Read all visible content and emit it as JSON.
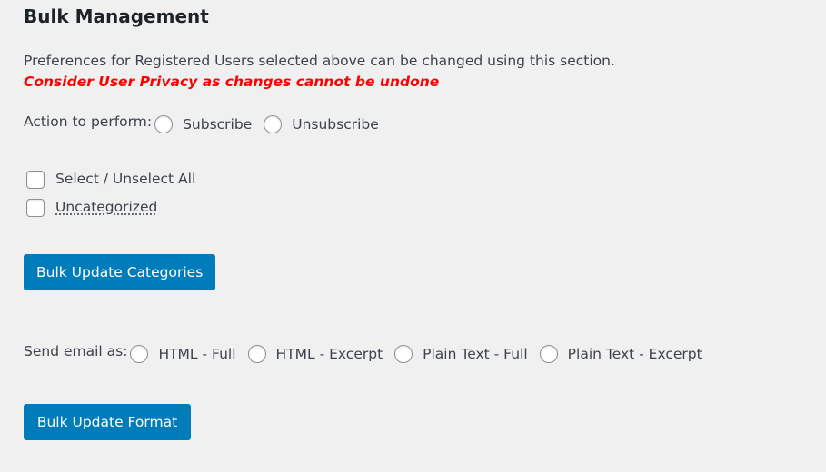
{
  "section": {
    "title": "Bulk Management",
    "description": "Preferences for Registered Users selected above can be changed using this section.",
    "warning": "Consider User Privacy as changes cannot be undone",
    "warning_color": "#ff0000"
  },
  "action": {
    "label": "Action to perform:",
    "options": [
      {
        "label": "Subscribe",
        "checked": false
      },
      {
        "label": "Unsubscribe",
        "checked": false
      }
    ]
  },
  "categories": {
    "select_all_label": "Select / Unselect All",
    "items": [
      {
        "label": "Uncategorized",
        "checked": false
      }
    ]
  },
  "buttons": {
    "bulk_update_categories": "Bulk Update Categories",
    "bulk_update_format": "Bulk Update Format",
    "accent_color": "#007cba"
  },
  "format": {
    "label": "Send email as:",
    "options": [
      {
        "label": "HTML - Full",
        "checked": false
      },
      {
        "label": "HTML - Excerpt",
        "checked": false
      },
      {
        "label": "Plain Text - Full",
        "checked": false
      },
      {
        "label": "Plain Text - Excerpt",
        "checked": false
      }
    ]
  }
}
